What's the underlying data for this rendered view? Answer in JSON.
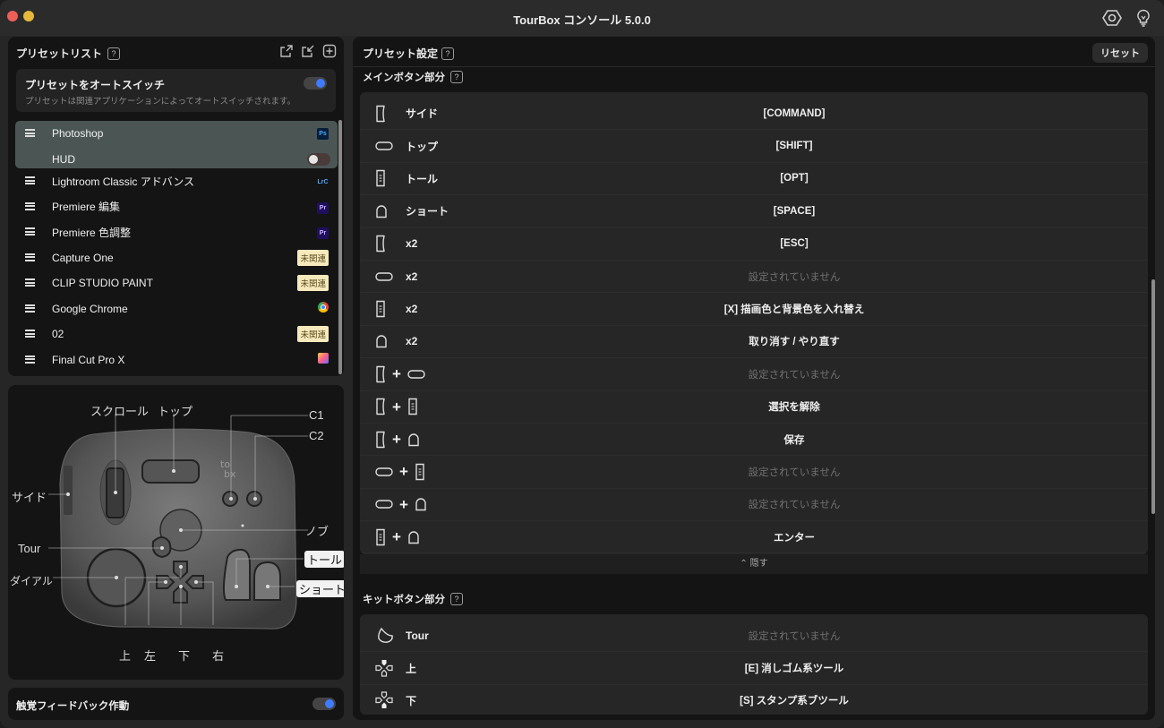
{
  "window": {
    "title": "TourBox コンソール 5.0.0",
    "settings_icon": "hex-gear-icon",
    "tips_icon": "lightbulb-icon"
  },
  "presets": {
    "header": "プリセットリスト",
    "help": "?",
    "actions": [
      "export-icon",
      "import-icon",
      "add-icon"
    ],
    "auto_switch": {
      "title": "プリセットをオートスイッチ",
      "description": "プリセットは関連アプリケーションによってオートスイッチされます。",
      "enabled": true
    },
    "active": {
      "name": "Photoshop",
      "app_badge": "Ps",
      "hud_label": "HUD",
      "hud_enabled": false
    },
    "items": [
      {
        "name": "Lightroom Classic アドバンス",
        "badge_type": "app",
        "badge": "LrC"
      },
      {
        "name": "Premiere 編集",
        "badge_type": "app",
        "badge": "Pr"
      },
      {
        "name": "Premiere 色調整",
        "badge_type": "app",
        "badge": "Pr"
      },
      {
        "name": "Capture One",
        "badge_type": "tag",
        "badge": "未関連"
      },
      {
        "name": "CLIP STUDIO PAINT",
        "badge_type": "tag",
        "badge": "未関連"
      },
      {
        "name": "Google Chrome",
        "badge_type": "chrome",
        "badge": ""
      },
      {
        "name": "02",
        "badge_type": "tag",
        "badge": "未関連"
      },
      {
        "name": "Final Cut Pro X",
        "badge_type": "fcp",
        "badge": ""
      }
    ]
  },
  "device": {
    "labels": {
      "scroll": "スクロール",
      "top": "トップ",
      "c1": "C1",
      "c2": "C2",
      "side": "サイド",
      "knob": "ノブ",
      "tour": "Tour",
      "tall": "トール",
      "dial": "ダイアル",
      "short": "ショート",
      "up": "上",
      "left": "左",
      "down": "下",
      "right": "右"
    }
  },
  "haptic": {
    "label": "触覚フィードバック作動",
    "enabled": true
  },
  "settings": {
    "header": "プリセット設定",
    "help": "?",
    "reset_label": "リセット",
    "main_section": {
      "title": "メインボタン部分",
      "rows": [
        {
          "icons": [
            "side"
          ],
          "label": "サイド",
          "value": "[COMMAND]",
          "set": true
        },
        {
          "icons": [
            "top"
          ],
          "label": "トップ",
          "value": "[SHIFT]",
          "set": true
        },
        {
          "icons": [
            "tall"
          ],
          "label": "トール",
          "value": "[OPT]",
          "set": true
        },
        {
          "icons": [
            "short"
          ],
          "label": "ショート",
          "value": "[SPACE]",
          "set": true
        },
        {
          "icons": [
            "side"
          ],
          "label": "x2",
          "value": "[ESC]",
          "set": true
        },
        {
          "icons": [
            "top"
          ],
          "label": "x2",
          "value": "設定されていません",
          "set": false
        },
        {
          "icons": [
            "tall"
          ],
          "label": "x2",
          "value": "[X] 描画色と背景色を入れ替え",
          "set": true
        },
        {
          "icons": [
            "short"
          ],
          "label": "x2",
          "value": "取り消す / やり直す",
          "set": true
        },
        {
          "icons": [
            "side",
            "top"
          ],
          "label": "",
          "value": "設定されていません",
          "set": false
        },
        {
          "icons": [
            "side",
            "tall"
          ],
          "label": "",
          "value": "選択を解除",
          "set": true
        },
        {
          "icons": [
            "side",
            "short"
          ],
          "label": "",
          "value": "保存",
          "set": true
        },
        {
          "icons": [
            "top",
            "tall"
          ],
          "label": "",
          "value": "設定されていません",
          "set": false
        },
        {
          "icons": [
            "top",
            "short"
          ],
          "label": "",
          "value": "設定されていません",
          "set": false
        },
        {
          "icons": [
            "tall",
            "short"
          ],
          "label": "",
          "value": "エンター",
          "set": true
        }
      ],
      "collapse_label": "隠す"
    },
    "kit_section": {
      "title": "キットボタン部分",
      "rows": [
        {
          "icons": [
            "tour"
          ],
          "label": "Tour",
          "value": "設定されていません",
          "set": false
        },
        {
          "icons": [
            "dpad-up"
          ],
          "label": "上",
          "value": "[E] 消しゴム系ツール",
          "set": true
        },
        {
          "icons": [
            "dpad-down"
          ],
          "label": "下",
          "value": "[S] スタンプ系ブツール",
          "set": true
        }
      ]
    }
  }
}
